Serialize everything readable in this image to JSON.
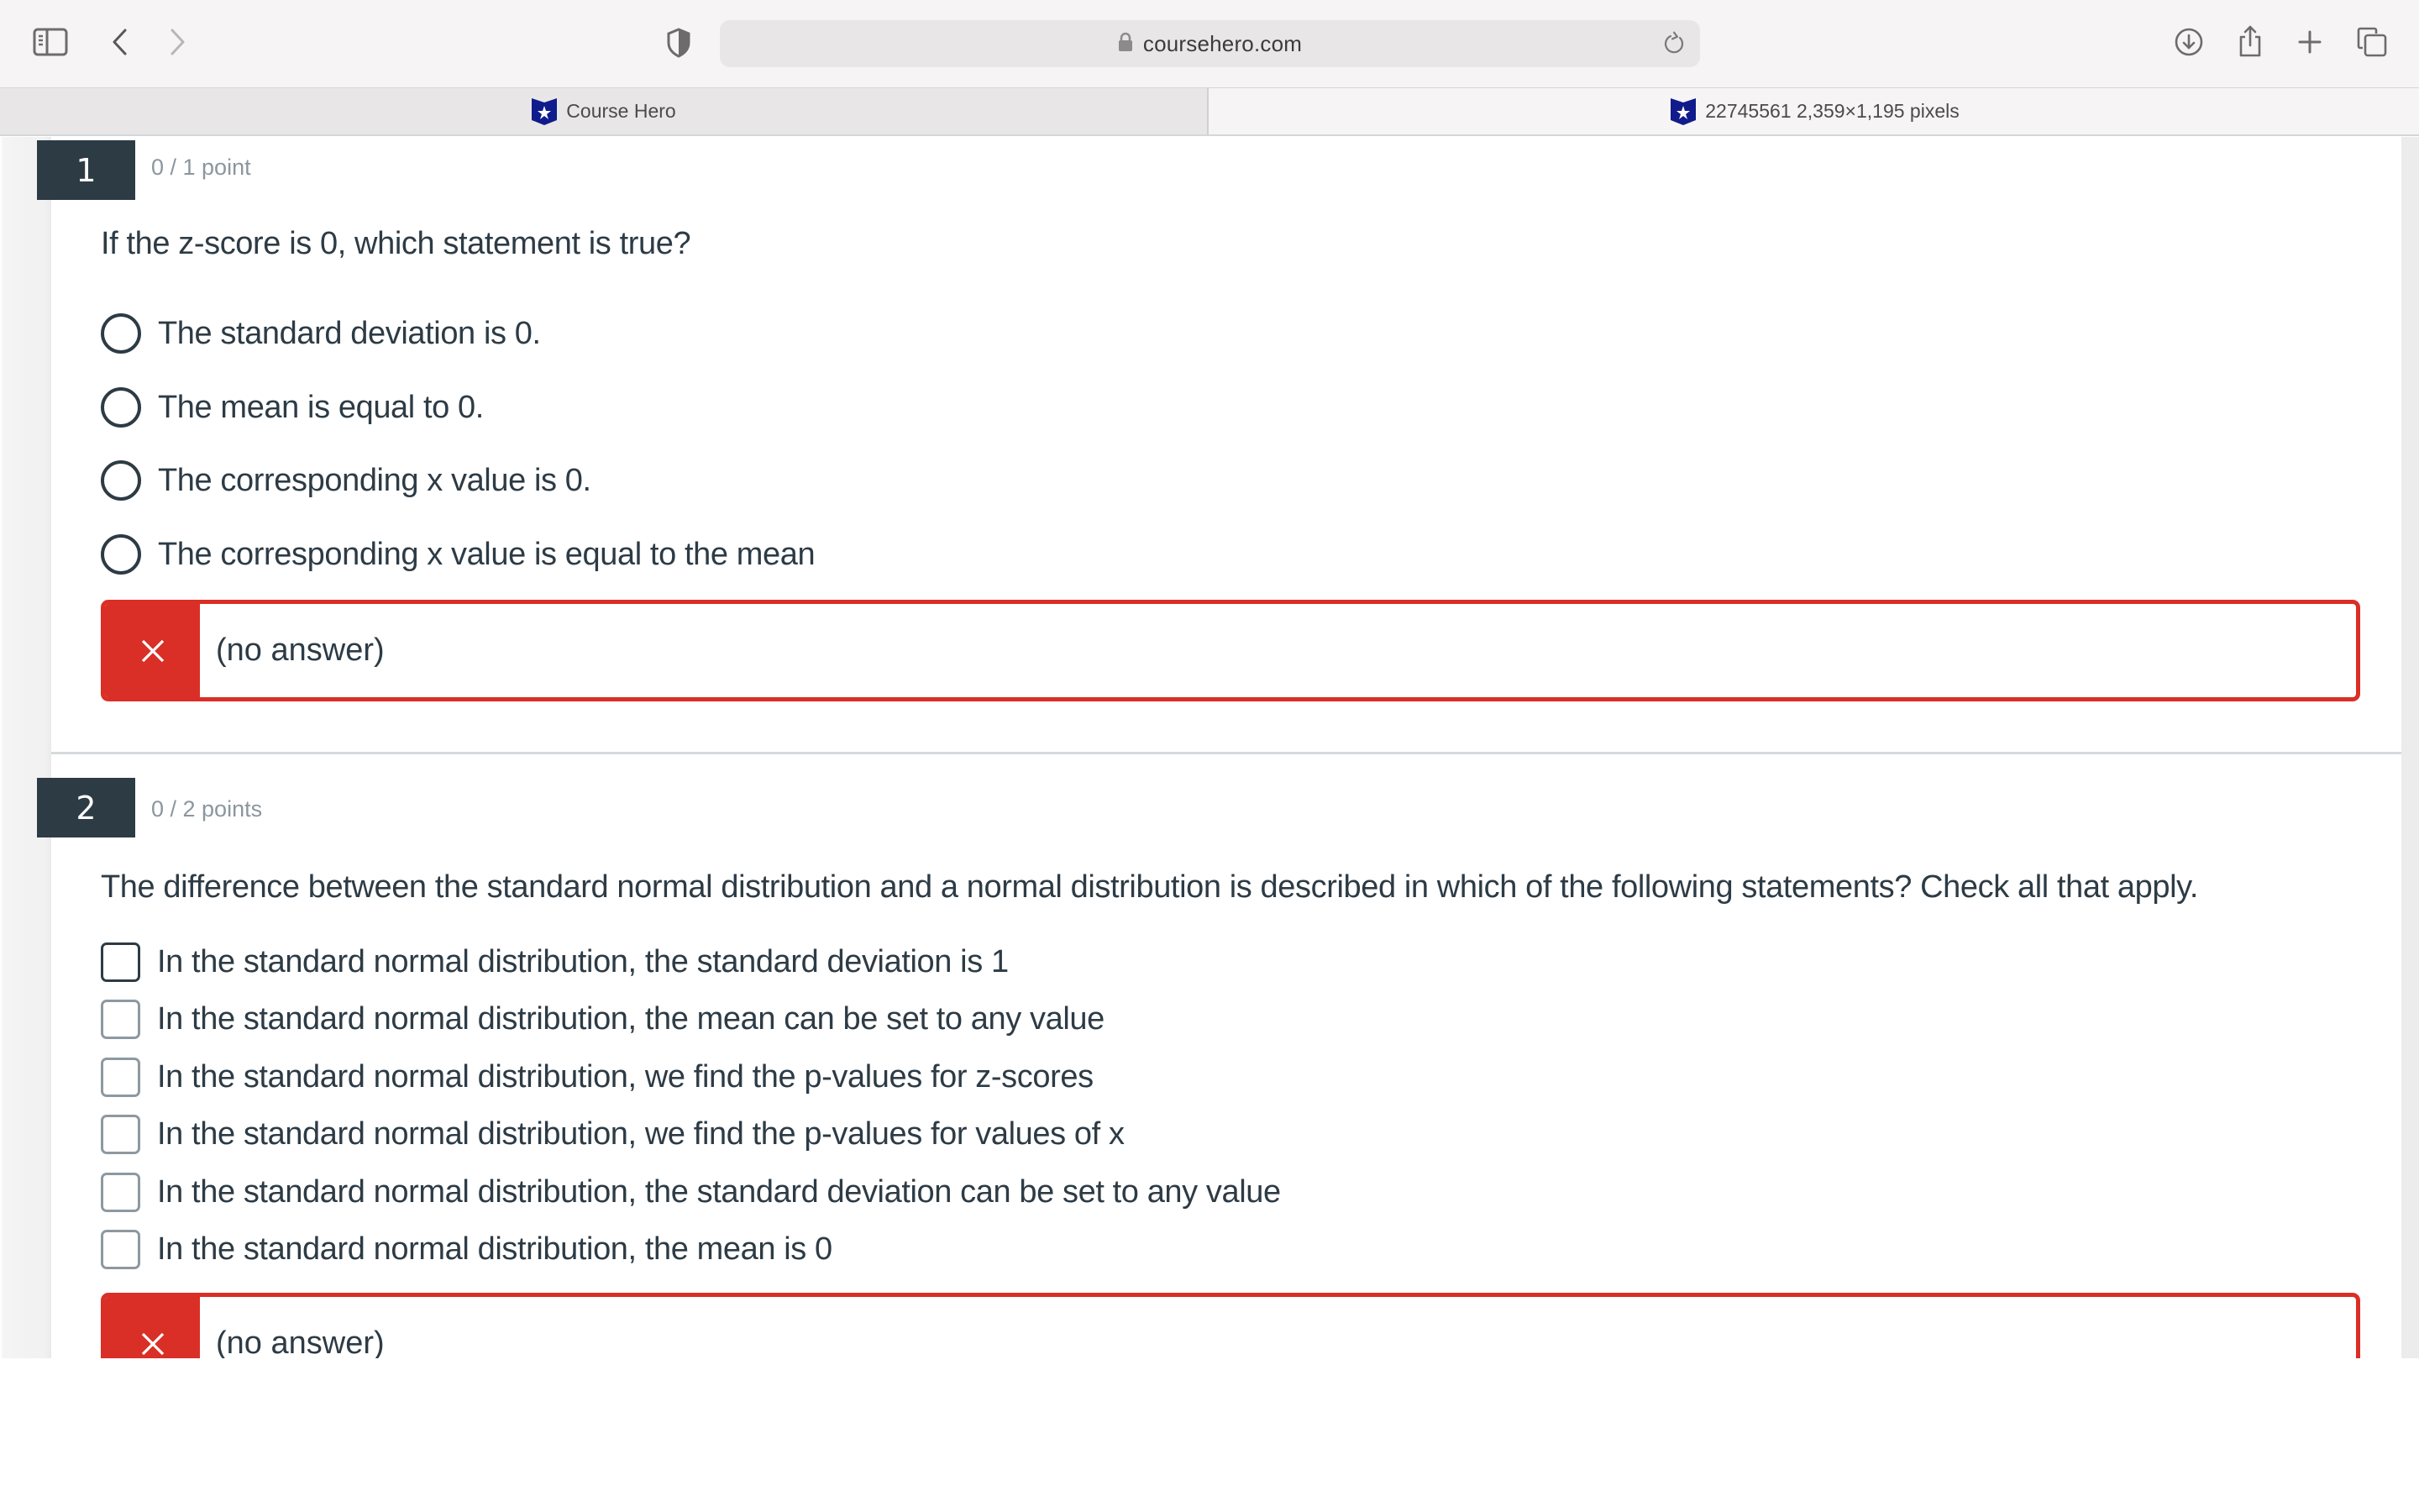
{
  "browser": {
    "url": "coursehero.com",
    "tabs": [
      {
        "title": "Course Hero",
        "active": false,
        "favicon": "coursehero-logo-icon"
      },
      {
        "title": "22745561 2,359×1,195 pixels",
        "active": true,
        "favicon": "coursehero-logo-icon"
      }
    ],
    "icons": {
      "sidebar": "sidebar-icon",
      "back": "chevron-left-icon",
      "forward": "chevron-right-icon",
      "privacy": "shield-icon",
      "lock": "lock-icon",
      "reload": "reload-icon",
      "downloads": "download-icon",
      "share": "share-icon",
      "new_tab": "plus-icon",
      "tab_overview": "tabs-icon"
    }
  },
  "colors": {
    "badge": "#2d3b45",
    "text": "#2d3b45",
    "points": "#8b969e",
    "incorrect": "#da2f26"
  },
  "quiz": {
    "questions": [
      {
        "number": "1",
        "points": "0 / 1 point",
        "text": "If the z-score is 0, which statement is true?",
        "type": "radio",
        "options": [
          "The standard deviation is 0.",
          "The mean is equal to 0.",
          "The corresponding x value is 0.",
          "The corresponding x value is equal to the mean"
        ],
        "feedback": {
          "status": "incorrect",
          "icon": "x-icon",
          "text": "(no answer)"
        }
      },
      {
        "number": "2",
        "points": "0 / 2 points",
        "text": "The difference between the standard normal distribution and a normal distribution is described in which of the following statements? Check all that apply.",
        "type": "checkbox",
        "options": [
          "In the standard normal distribution, the standard deviation is 1",
          "In the standard normal distribution, the mean can be set to any value",
          "In the standard normal distribution, we find the p-values for z-scores",
          "In the standard normal distribution, we find the p-values for values of x",
          "In the standard normal distribution, the standard deviation can be set to any value",
          "In the standard normal distribution, the mean is 0"
        ],
        "feedback": {
          "status": "incorrect",
          "icon": "x-icon",
          "text": "(no answer)"
        }
      }
    ]
  }
}
